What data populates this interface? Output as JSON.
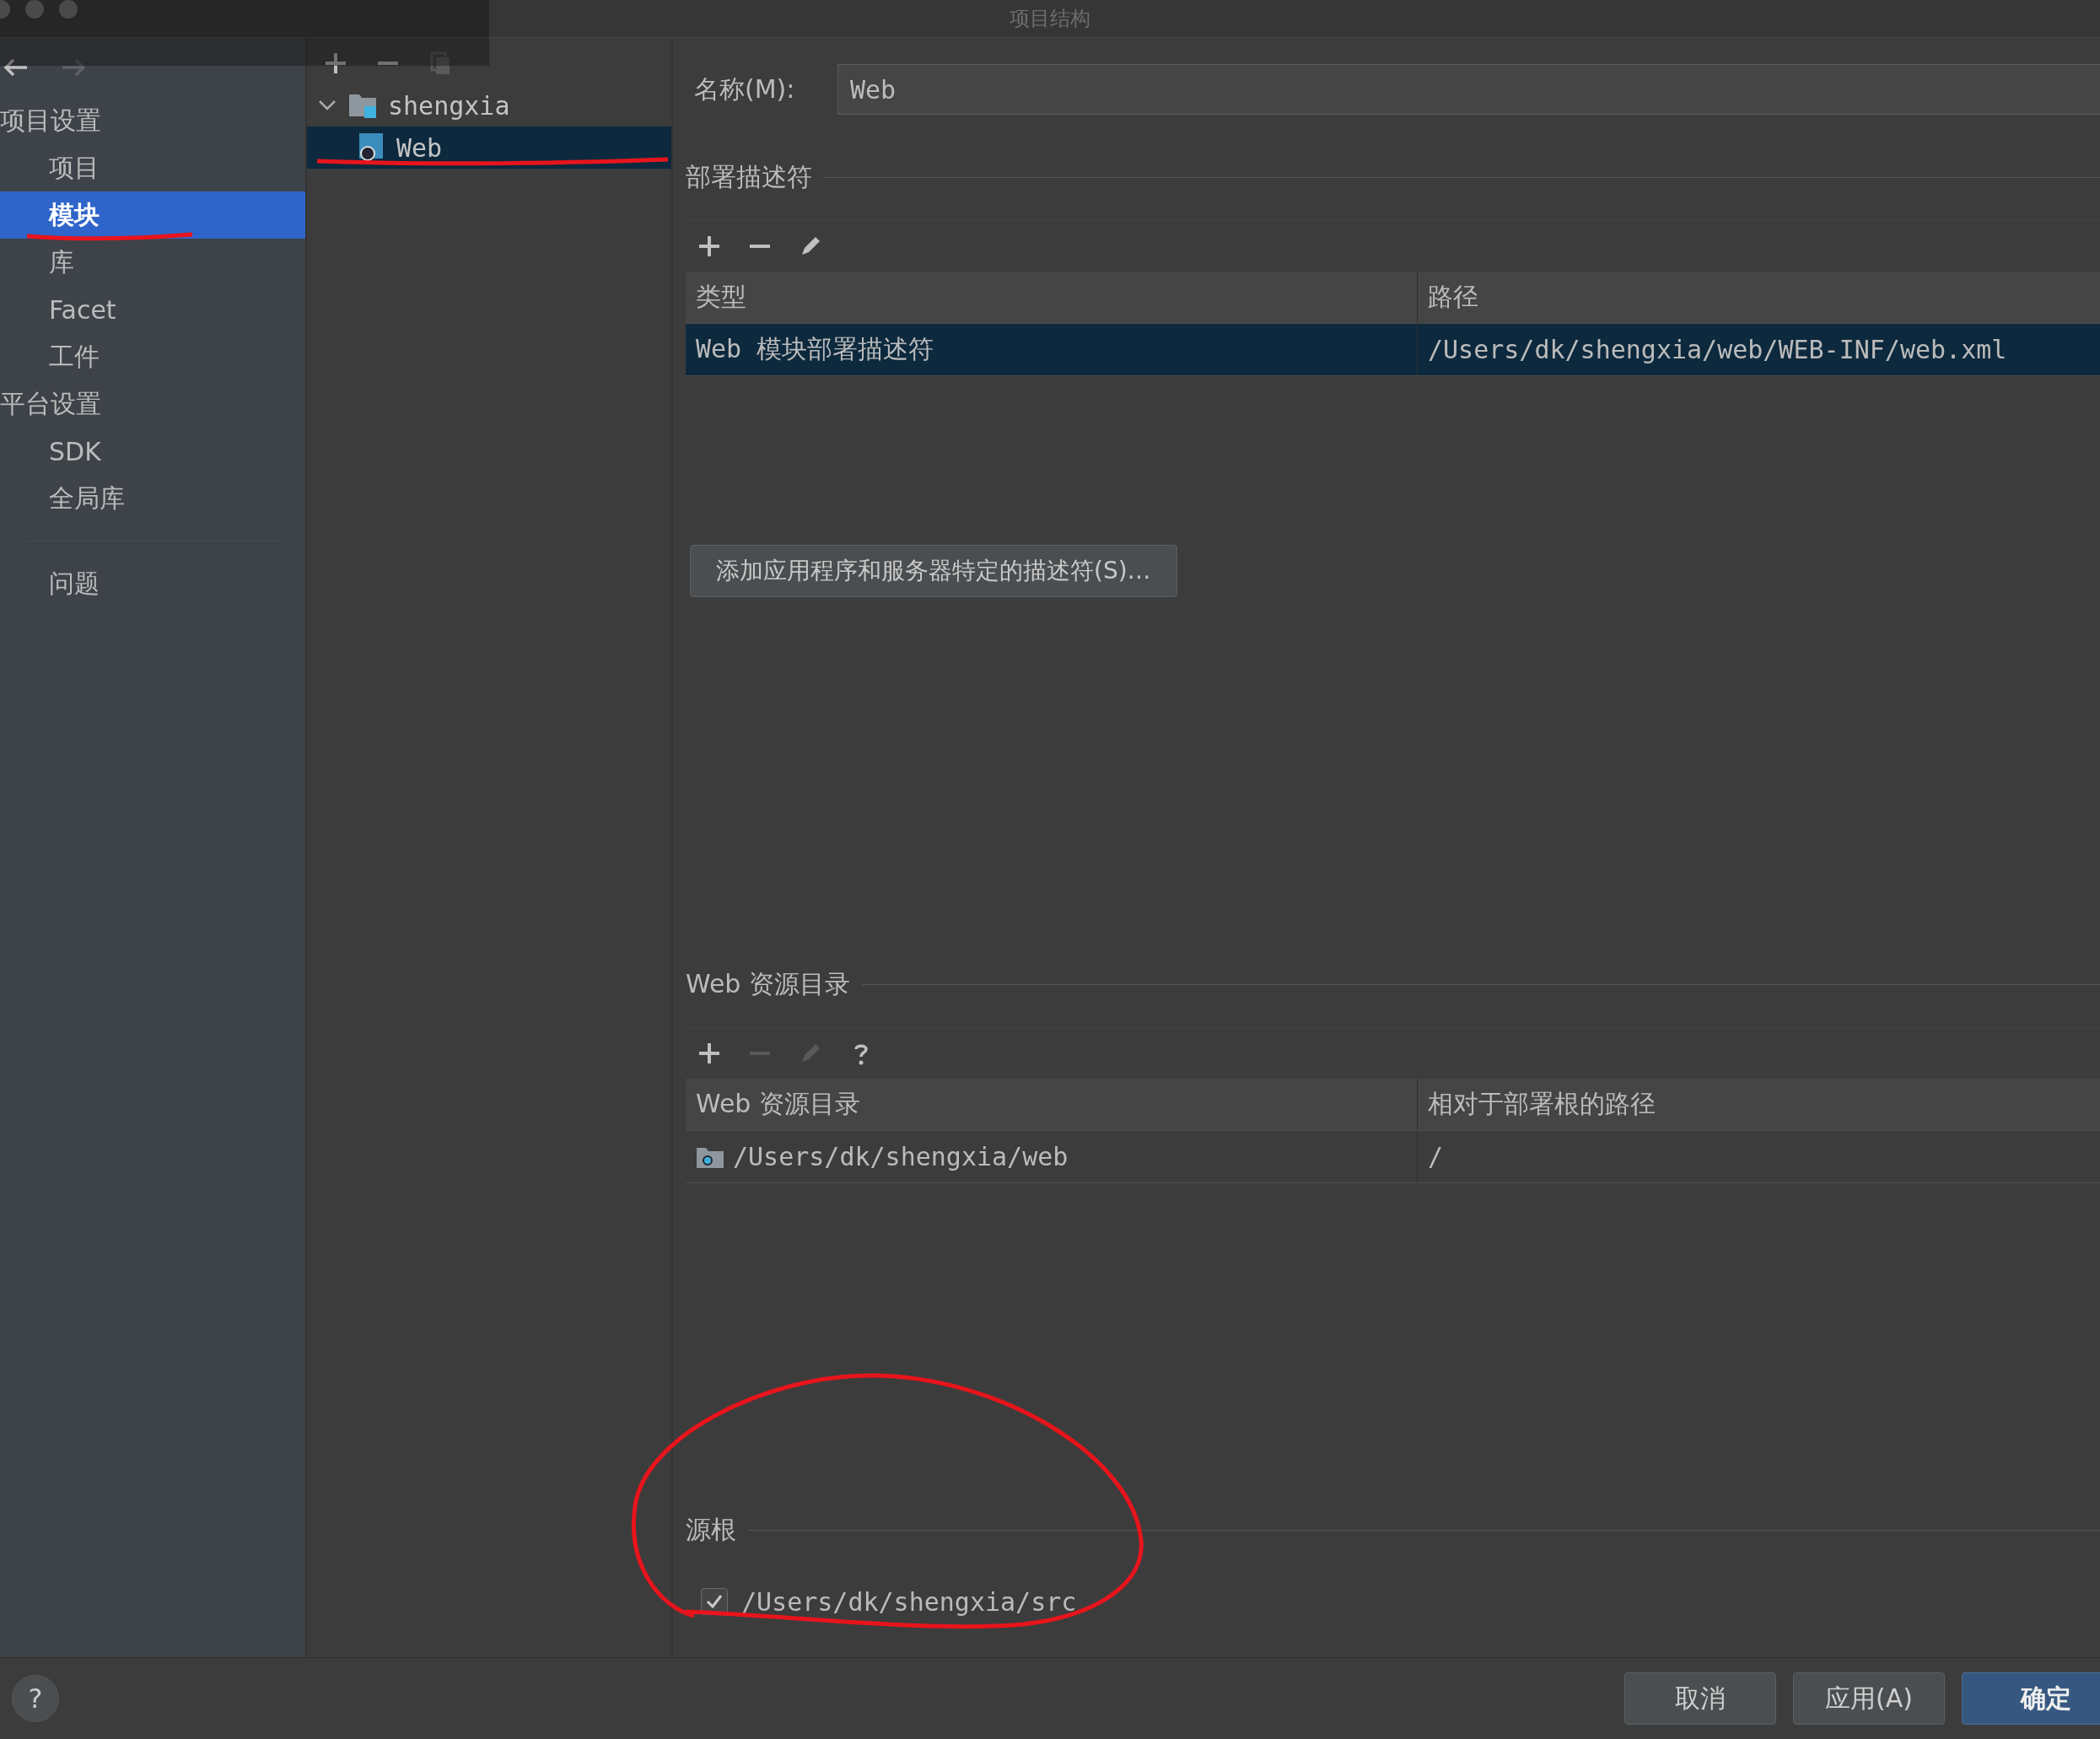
{
  "window": {
    "title": "项目结构"
  },
  "nav": [
    {
      "kind": "back",
      "disabled": false
    },
    {
      "kind": "forward",
      "disabled": true
    }
  ],
  "tree_toolbar": [
    {
      "kind": "add",
      "disabled": false
    },
    {
      "kind": "remove",
      "disabled": false
    },
    {
      "kind": "copy",
      "disabled": true
    }
  ],
  "sidebar": {
    "items": [
      {
        "kind": "header",
        "label": "项目设置",
        "selected": false
      },
      {
        "kind": "item",
        "label": "项目",
        "selected": false
      },
      {
        "kind": "item",
        "label": "模块",
        "selected": true,
        "marked": true
      },
      {
        "kind": "item",
        "label": "库",
        "selected": false
      },
      {
        "kind": "item",
        "label": "Facet",
        "selected": false
      },
      {
        "kind": "item",
        "label": "工件",
        "selected": false
      },
      {
        "kind": "header",
        "label": "平台设置",
        "selected": false
      },
      {
        "kind": "item",
        "label": "SDK",
        "selected": false
      },
      {
        "kind": "item",
        "label": "全局库",
        "selected": false
      },
      {
        "kind": "separator"
      },
      {
        "kind": "item",
        "label": "问题",
        "selected": false
      }
    ]
  },
  "tree": [
    {
      "label": "shengxia",
      "kind": "folder",
      "expanded": true,
      "selected": false,
      "children": [
        {
          "label": "Web",
          "kind": "web",
          "selected": true,
          "marked": true
        }
      ]
    }
  ],
  "name_field": {
    "label": "名称(M):",
    "value": "Web"
  },
  "deployment": {
    "title": "部署描述符",
    "toolbar": [
      {
        "kind": "add",
        "disabled": false
      },
      {
        "kind": "remove",
        "disabled": false
      },
      {
        "kind": "edit",
        "disabled": false
      }
    ],
    "table": {
      "columns": [
        "类型",
        "路径"
      ],
      "rows": [
        {
          "cells": [
            "Web 模块部署描述符",
            "/Users/dk/shengxia/web/WEB-INF/web.xml"
          ],
          "selected": true
        }
      ]
    },
    "button": "添加应用程序和服务器特定的描述符(S)…"
  },
  "web_resources": {
    "title": "Web 资源目录",
    "toolbar": [
      {
        "kind": "add",
        "disabled": false
      },
      {
        "kind": "remove",
        "disabled": true
      },
      {
        "kind": "edit",
        "disabled": true
      },
      {
        "kind": "help",
        "disabled": false
      }
    ],
    "table": {
      "columns": [
        "Web 资源目录",
        "相对于部署根的路径"
      ],
      "rows": [
        {
          "cells": [
            "/Users/dk/shengxia/web",
            "/"
          ],
          "selected": false
        }
      ]
    }
  },
  "source_roots": {
    "title": "源根",
    "circled": true,
    "items": [
      {
        "label": "/Users/dk/shengxia/src",
        "checked": true
      }
    ]
  },
  "footer": {
    "help": "?",
    "buttons": [
      {
        "label": "取消",
        "kind": "default"
      },
      {
        "label": "应用(A)",
        "kind": "default"
      },
      {
        "label": "确定",
        "kind": "primary"
      }
    ]
  }
}
